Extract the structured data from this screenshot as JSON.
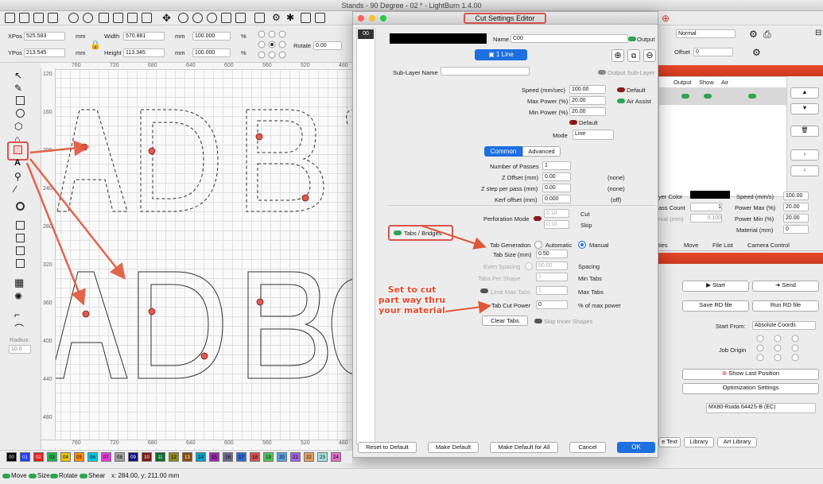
{
  "app": {
    "title": "Stands - 90 Degree - 02 * - LightBurn 1.4.00"
  },
  "toolbar": {
    "xpos_label": "XPos",
    "xpos_value": "525.583",
    "ypos_label": "YPos",
    "ypos_value": "213.545",
    "unit": "mm",
    "width_label": "Width",
    "width_value": "570.881",
    "height_label": "Height",
    "height_value": "113.345",
    "scale_x": "100.000",
    "scale_y": "100.000",
    "pct": "%",
    "rotate_label": "Rotate",
    "rotate_value": "0.00",
    "normal": "Normal",
    "offset_label": "Offset",
    "offset_value": "0"
  },
  "rulers": {
    "top": [
      "760",
      "720",
      "680",
      "640",
      "600",
      "560",
      "520",
      "480",
      "440"
    ],
    "left": [
      "120",
      "160",
      "200",
      "240",
      "280",
      "320",
      "360",
      "400",
      "440",
      "480"
    ],
    "bottom": [
      "760",
      "720",
      "680",
      "640",
      "600",
      "560",
      "520",
      "480",
      "440"
    ]
  },
  "canvas": {
    "row1": [
      "A",
      "D",
      "B",
      "C"
    ],
    "row2": [
      "A",
      "D",
      "B",
      "C"
    ]
  },
  "toolcol": {
    "radius_label": "Radius:",
    "radius_value": "10.0"
  },
  "dialog": {
    "title": "Cut Settings Editor",
    "layer_tab": "00",
    "name_label": "Name",
    "name_value": "C00",
    "output_label": "Output",
    "line_button": "1 Line",
    "sublayer_label": "Sub-Layer Name",
    "output_sublayer": "Output Sub-Layer",
    "speed_label": "Speed (mm/sec)",
    "speed_value": "100.00",
    "default_label": "Default",
    "maxpower_label": "Max Power (%)",
    "maxpower_value": "20.00",
    "air_assist": "Air Assist",
    "minpower_label": "Min Power (%)",
    "minpower_value": "20.00",
    "default2": "Default",
    "mode_label": "Mode",
    "mode_value": "Line",
    "tab_common": "Common",
    "tab_advanced": "Advanced",
    "passes_label": "Number of Passes",
    "passes_value": "1",
    "zoffset_label": "Z Offset (mm)",
    "zoffset_value": "0.00",
    "zoffset_note": "(none)",
    "zstep_label": "Z step per pass (mm)",
    "zstep_value": "0.00",
    "zstep_note": "(none)",
    "kerf_label": "Kerf offset (mm)",
    "kerf_value": "0.000",
    "kerf_note": "(off)",
    "perf_label": "Perforation Mode",
    "cut_value": "0.10",
    "cut_label": "Cut",
    "skip_value": "0.10",
    "skip_label": "Skip",
    "tabs_label": "Tabs / Bridges",
    "tabgen_label": "Tab Generation",
    "automatic": "Automatic",
    "manual": "Manual",
    "tabsize_label": "Tab Size (mm)",
    "tabsize_value": "0.50",
    "spacing_label": "Even Spacing",
    "spacing_value": "50.00",
    "spacing_unit": "Spacing",
    "tabspershape_label": "Tabs Per Shape",
    "tabspershape_value": "1",
    "mintabs": "Min Tabs",
    "limit_label": "Limit Max Tabs",
    "limit_value": "1",
    "maxtabs": "Max Tabs",
    "tabcut_label": "Tab Cut Power",
    "tabcut_value": "0",
    "tabcut_unit": "% of max power",
    "clear_tabs": "Clear Tabs",
    "skip_inner": "Skip Inner Shapes",
    "reset": "Reset to Default",
    "make_default": "Make Default",
    "make_default_all": "Make Default for All",
    "cancel": "Cancel",
    "ok": "OK"
  },
  "annotation": {
    "line1": "Set to cut",
    "line2": "part way thru",
    "line3": "your material"
  },
  "right_panel": {
    "output": "Output",
    "show": "Show",
    "air": "Air",
    "layer_color": "yer Color",
    "speed_label": "Speed (mm/s)",
    "speed_value": "100.00",
    "pass_count": "ass Count",
    "pass_value": "1",
    "power_max_label": "Power Max (%)",
    "power_max_value": "20.00",
    "interval": "rval (mm)",
    "interval_value": "0.100",
    "power_min_label": "Power Min (%)",
    "power_min_value": "20.00",
    "material_label": "Material (mm)",
    "material_value": "0",
    "tabs": [
      "ties",
      "Move",
      "File List",
      "Camera Control"
    ],
    "start": "Start",
    "send": "Send",
    "save_rd": "Save RD file",
    "run_rd": "Run RD file",
    "start_from_label": "Start From:",
    "start_from_value": "Absolute Coords",
    "job_origin": "Job Origin",
    "show_last": "Show Last Position",
    "optimization": "Optimization Settings",
    "device": "MX80-Ruida 6442S-B (EC)",
    "bottom_tabs": [
      "e Text",
      "Library",
      "Art Library"
    ]
  },
  "palette": [
    "00",
    "01",
    "02",
    "03",
    "04",
    "05",
    "06",
    "07",
    "08",
    "09",
    "10",
    "11",
    "12",
    "13",
    "14",
    "15",
    "16",
    "17",
    "18",
    "19",
    "20",
    "21",
    "22",
    "23",
    "24"
  ],
  "palette_colors": [
    "#000000",
    "#1e3cff",
    "#e02020",
    "#22b14c",
    "#e8c400",
    "#ff8c00",
    "#00c8e0",
    "#e040e0",
    "#a0a0a0",
    "#101080",
    "#7a1a1a",
    "#0a6a2a",
    "#8a8a1a",
    "#8a4a00",
    "#00a0c8",
    "#9a2aaa",
    "#6a6a8a",
    "#2a6ad0",
    "#d05050",
    "#50c060",
    "#50a0e0",
    "#a060e0",
    "#e0a060",
    "#a0e0e0",
    "#e070c0"
  ],
  "status": {
    "move": "Move",
    "size": "Size",
    "rotate": "Rotate",
    "shear": "Shear",
    "coords": "x: 284.00, y: 211.00 mm"
  }
}
